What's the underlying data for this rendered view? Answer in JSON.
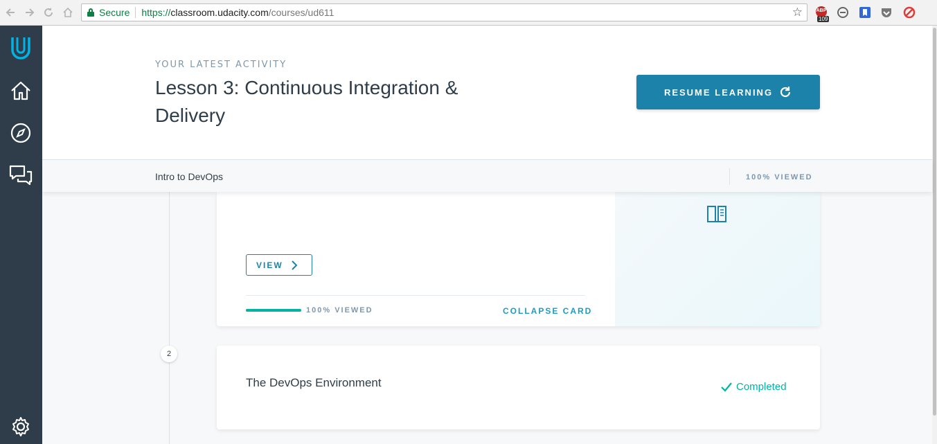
{
  "browser": {
    "secure_label": "Secure",
    "url_proto": "https://",
    "url_host": "classroom.udacity.com",
    "url_path": "/courses/ud611",
    "ext_badge_label": "ABP",
    "ext_badge_count": "109"
  },
  "sidebar": {
    "items": [
      {
        "icon": "udacity-logo-icon"
      },
      {
        "icon": "home-icon"
      },
      {
        "icon": "compass-icon"
      },
      {
        "icon": "chat-icon"
      },
      {
        "icon": "gear-icon"
      }
    ]
  },
  "header": {
    "eyebrow": "YOUR LATEST ACTIVITY",
    "lesson_title": "Lesson 3: Continuous Integration & Delivery",
    "resume_label": "RESUME LEARNING"
  },
  "subbar": {
    "course_name": "Intro to DevOps",
    "viewed": "100% VIEWED"
  },
  "cards": [
    {
      "view_label": "VIEW",
      "progress": 1.0,
      "viewed": "100% VIEWED",
      "collapse_label": "COLLAPSE CARD"
    },
    {
      "step": "2",
      "title": "The DevOps Environment",
      "status": "Completed"
    }
  ],
  "colors": {
    "sidebar": "#2e3d49",
    "accent": "#1d82a9",
    "success": "#02b3a4"
  }
}
